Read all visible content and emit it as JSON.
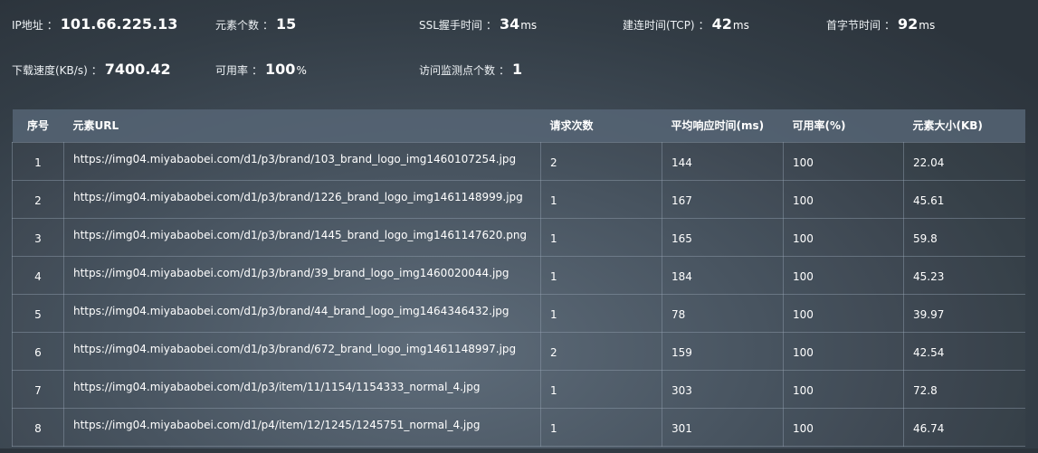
{
  "summary": {
    "ip": {
      "label": "IP地址",
      "value": "101.66.225.13",
      "unit": ""
    },
    "element_count": {
      "label": "元素个数",
      "value": "15",
      "unit": ""
    },
    "ssl_time": {
      "label": "SSL握手时间",
      "value": "34",
      "unit": "ms"
    },
    "tcp_time": {
      "label": "建连时间(TCP)",
      "value": "42",
      "unit": "ms"
    },
    "first_byte": {
      "label": "首字节时间",
      "value": "92",
      "unit": "ms"
    },
    "download_speed": {
      "label": "下载速度(KB/s)",
      "value": "7400.42",
      "unit": ""
    },
    "availability": {
      "label": "可用率",
      "value": "100",
      "unit": "%"
    },
    "monitor_points": {
      "label": "访问监测点个数",
      "value": "1",
      "unit": ""
    },
    "separator": "："
  },
  "table": {
    "headers": [
      "序号",
      "元素URL",
      "请求次数",
      "平均响应时间(ms)",
      "可用率(%)",
      "元素大小(KB)"
    ],
    "rows": [
      [
        "1",
        "https://img04.miyabaobei.com/d1/p3/brand/103_brand_logo_img1460107254.jpg",
        "2",
        "144",
        "100",
        "22.04"
      ],
      [
        "2",
        "https://img04.miyabaobei.com/d1/p3/brand/1226_brand_logo_img1461148999.jpg",
        "1",
        "167",
        "100",
        "45.61"
      ],
      [
        "3",
        "https://img04.miyabaobei.com/d1/p3/brand/1445_brand_logo_img1461147620.png",
        "1",
        "165",
        "100",
        "59.8"
      ],
      [
        "4",
        "https://img04.miyabaobei.com/d1/p3/brand/39_brand_logo_img1460020044.jpg",
        "1",
        "184",
        "100",
        "45.23"
      ],
      [
        "5",
        "https://img04.miyabaobei.com/d1/p3/brand/44_brand_logo_img1464346432.jpg",
        "1",
        "78",
        "100",
        "39.97"
      ],
      [
        "6",
        "https://img04.miyabaobei.com/d1/p3/brand/672_brand_logo_img1461148997.jpg",
        "2",
        "159",
        "100",
        "42.54"
      ],
      [
        "7",
        "https://img04.miyabaobei.com/d1/p3/item/11/1154/1154333_normal_4.jpg",
        "1",
        "303",
        "100",
        "72.8"
      ],
      [
        "8",
        "https://img04.miyabaobei.com/d1/p4/item/12/1245/1245751_normal_4.jpg",
        "1",
        "301",
        "100",
        "46.74"
      ]
    ]
  }
}
